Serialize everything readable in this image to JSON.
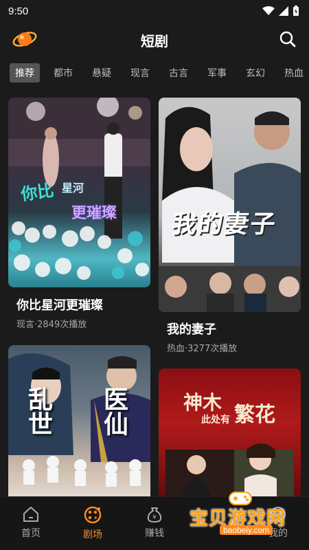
{
  "status_bar": {
    "time": "9:50"
  },
  "header": {
    "title": "短剧"
  },
  "tabs": [
    {
      "label": "推荐",
      "active": true
    },
    {
      "label": "都市",
      "active": false
    },
    {
      "label": "悬疑",
      "active": false
    },
    {
      "label": "现言",
      "active": false
    },
    {
      "label": "古言",
      "active": false
    },
    {
      "label": "军事",
      "active": false
    },
    {
      "label": "玄幻",
      "active": false
    },
    {
      "label": "热血",
      "active": false
    }
  ],
  "dramas": [
    {
      "title": "你比星河更璀璨",
      "meta": "现言·2849次播放",
      "poster_text_1": "你比",
      "poster_text_2": "星河",
      "poster_text_3": "更璀璨"
    },
    {
      "title": "我的妻子",
      "meta": "热血·3277次播放",
      "poster_text": "我的妻子"
    },
    {
      "title": "",
      "meta": "",
      "poster_text_1": "乱世",
      "poster_text_2": "医仙"
    },
    {
      "title": "",
      "meta": "",
      "poster_text_1": "神木",
      "poster_text_2": "此处有",
      "poster_text_3": "繁花"
    }
  ],
  "bottom_nav": [
    {
      "label": "首页",
      "icon": "home-icon",
      "active": false
    },
    {
      "label": "剧场",
      "icon": "film-reel-icon",
      "active": true
    },
    {
      "label": "赚钱",
      "icon": "money-bag-icon",
      "active": false
    },
    {
      "label": "",
      "icon": "",
      "active": false
    },
    {
      "label": "我的",
      "icon": "profile-icon",
      "active": false
    }
  ],
  "watermark": {
    "text": "宝贝游戏网",
    "url": "baobeiy.com"
  },
  "colors": {
    "accent": "#ff8a1f",
    "background": "#1b1b1b"
  }
}
